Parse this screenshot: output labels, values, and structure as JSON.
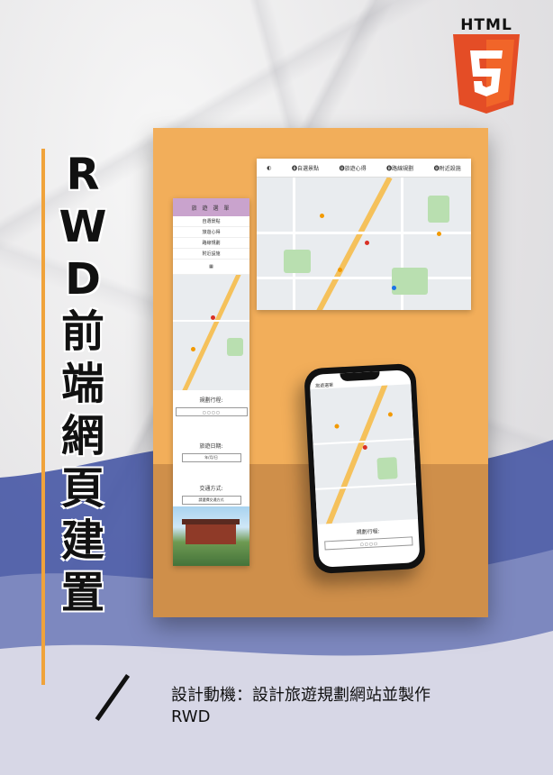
{
  "title_chars": [
    "R",
    "W",
    "D",
    "前",
    "端",
    "網",
    "頁",
    "建",
    "置"
  ],
  "badge": {
    "label": "HTML",
    "number": "5",
    "color": "#e44d26"
  },
  "description": "設計動機：設計旅遊規劃網站並製作RWD",
  "colors": {
    "orange_card": "#f2ae5a",
    "accent_bar": "#f0a33b",
    "wave_blue": "#4a5aa6",
    "mobile_header": "#c9a3cd"
  },
  "desktop_mock": {
    "nav": [
      "🅑自選景點",
      "🅑旅遊心得",
      "🅑路線規劃",
      "🅑附近設施"
    ]
  },
  "mobile_mock": {
    "header": "旅 遊 選 單",
    "menu": [
      "自選景點",
      "旅遊心得",
      "路線規劃",
      "附近設施"
    ],
    "plan_title": "規劃行程:",
    "date_title": "旅遊日期:",
    "date_value": "年/月/日",
    "transport_title": "交通方式:",
    "transport_value": "請選擇交通方式"
  },
  "phone_mock": {
    "plan_title": "規劃行程:",
    "header": "旅遊選單"
  }
}
